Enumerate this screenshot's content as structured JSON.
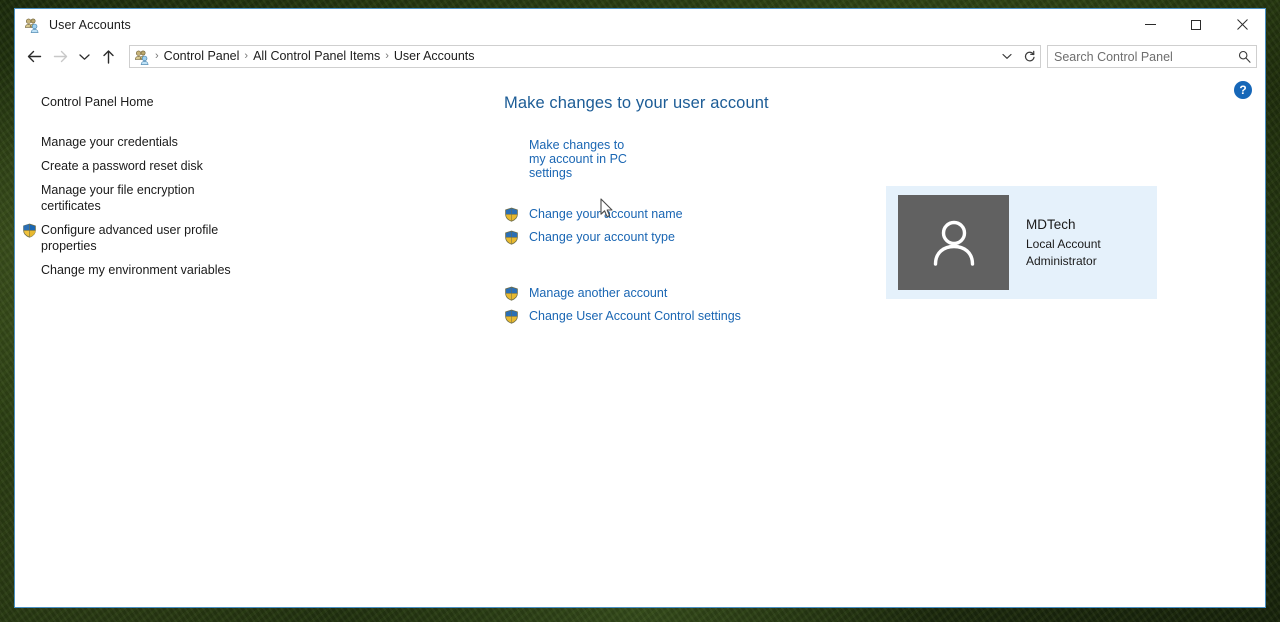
{
  "window": {
    "title": "User Accounts",
    "title_icon": "user-accounts-icon",
    "controls": {
      "minimize": "–",
      "maximize": "□",
      "close": "✕"
    }
  },
  "navbar": {
    "back_icon": "back-arrow-icon",
    "forward_icon": "forward-arrow-icon",
    "recent_icon": "chevron-down-icon",
    "up_icon": "up-arrow-icon",
    "address_icon": "user-accounts-icon",
    "breadcrumbs": [
      "Control Panel",
      "All Control Panel Items",
      "User Accounts"
    ],
    "separator": "›",
    "dropdown_icon": "chevron-down-icon",
    "refresh_icon": "refresh-icon",
    "search": {
      "placeholder": "Search Control Panel",
      "value": "",
      "icon": "search-icon"
    }
  },
  "sidebar": {
    "home_label": "Control Panel Home",
    "items": [
      {
        "label": "Manage your credentials",
        "shield": false
      },
      {
        "label": "Create a password reset disk",
        "shield": false
      },
      {
        "label": "Manage your file encryption certificates",
        "shield": false
      },
      {
        "label": "Configure advanced user profile properties",
        "shield": true
      },
      {
        "label": "Change my environment variables",
        "shield": false
      }
    ]
  },
  "main": {
    "heading": "Make changes to your user account",
    "pc_settings_link": "Make changes to my account in PC settings",
    "group_one": [
      {
        "label": "Change your account name",
        "shield": true
      },
      {
        "label": "Change your account type",
        "shield": true
      }
    ],
    "group_two": [
      {
        "label": "Manage another account",
        "shield": true
      },
      {
        "label": "Change User Account Control settings",
        "shield": true
      }
    ]
  },
  "account": {
    "avatar_icon": "user-avatar-icon",
    "name": "MDTech",
    "account_type": "Local Account",
    "role": "Administrator"
  },
  "help": {
    "label": "?",
    "icon": "help-icon"
  },
  "colors": {
    "heading": "#1c5c96",
    "link": "#1a66b3",
    "tile_background": "#e5f1fb",
    "avatar_background": "#616161",
    "window_border": "#4a90c4",
    "help_blue": "#1667b8"
  }
}
